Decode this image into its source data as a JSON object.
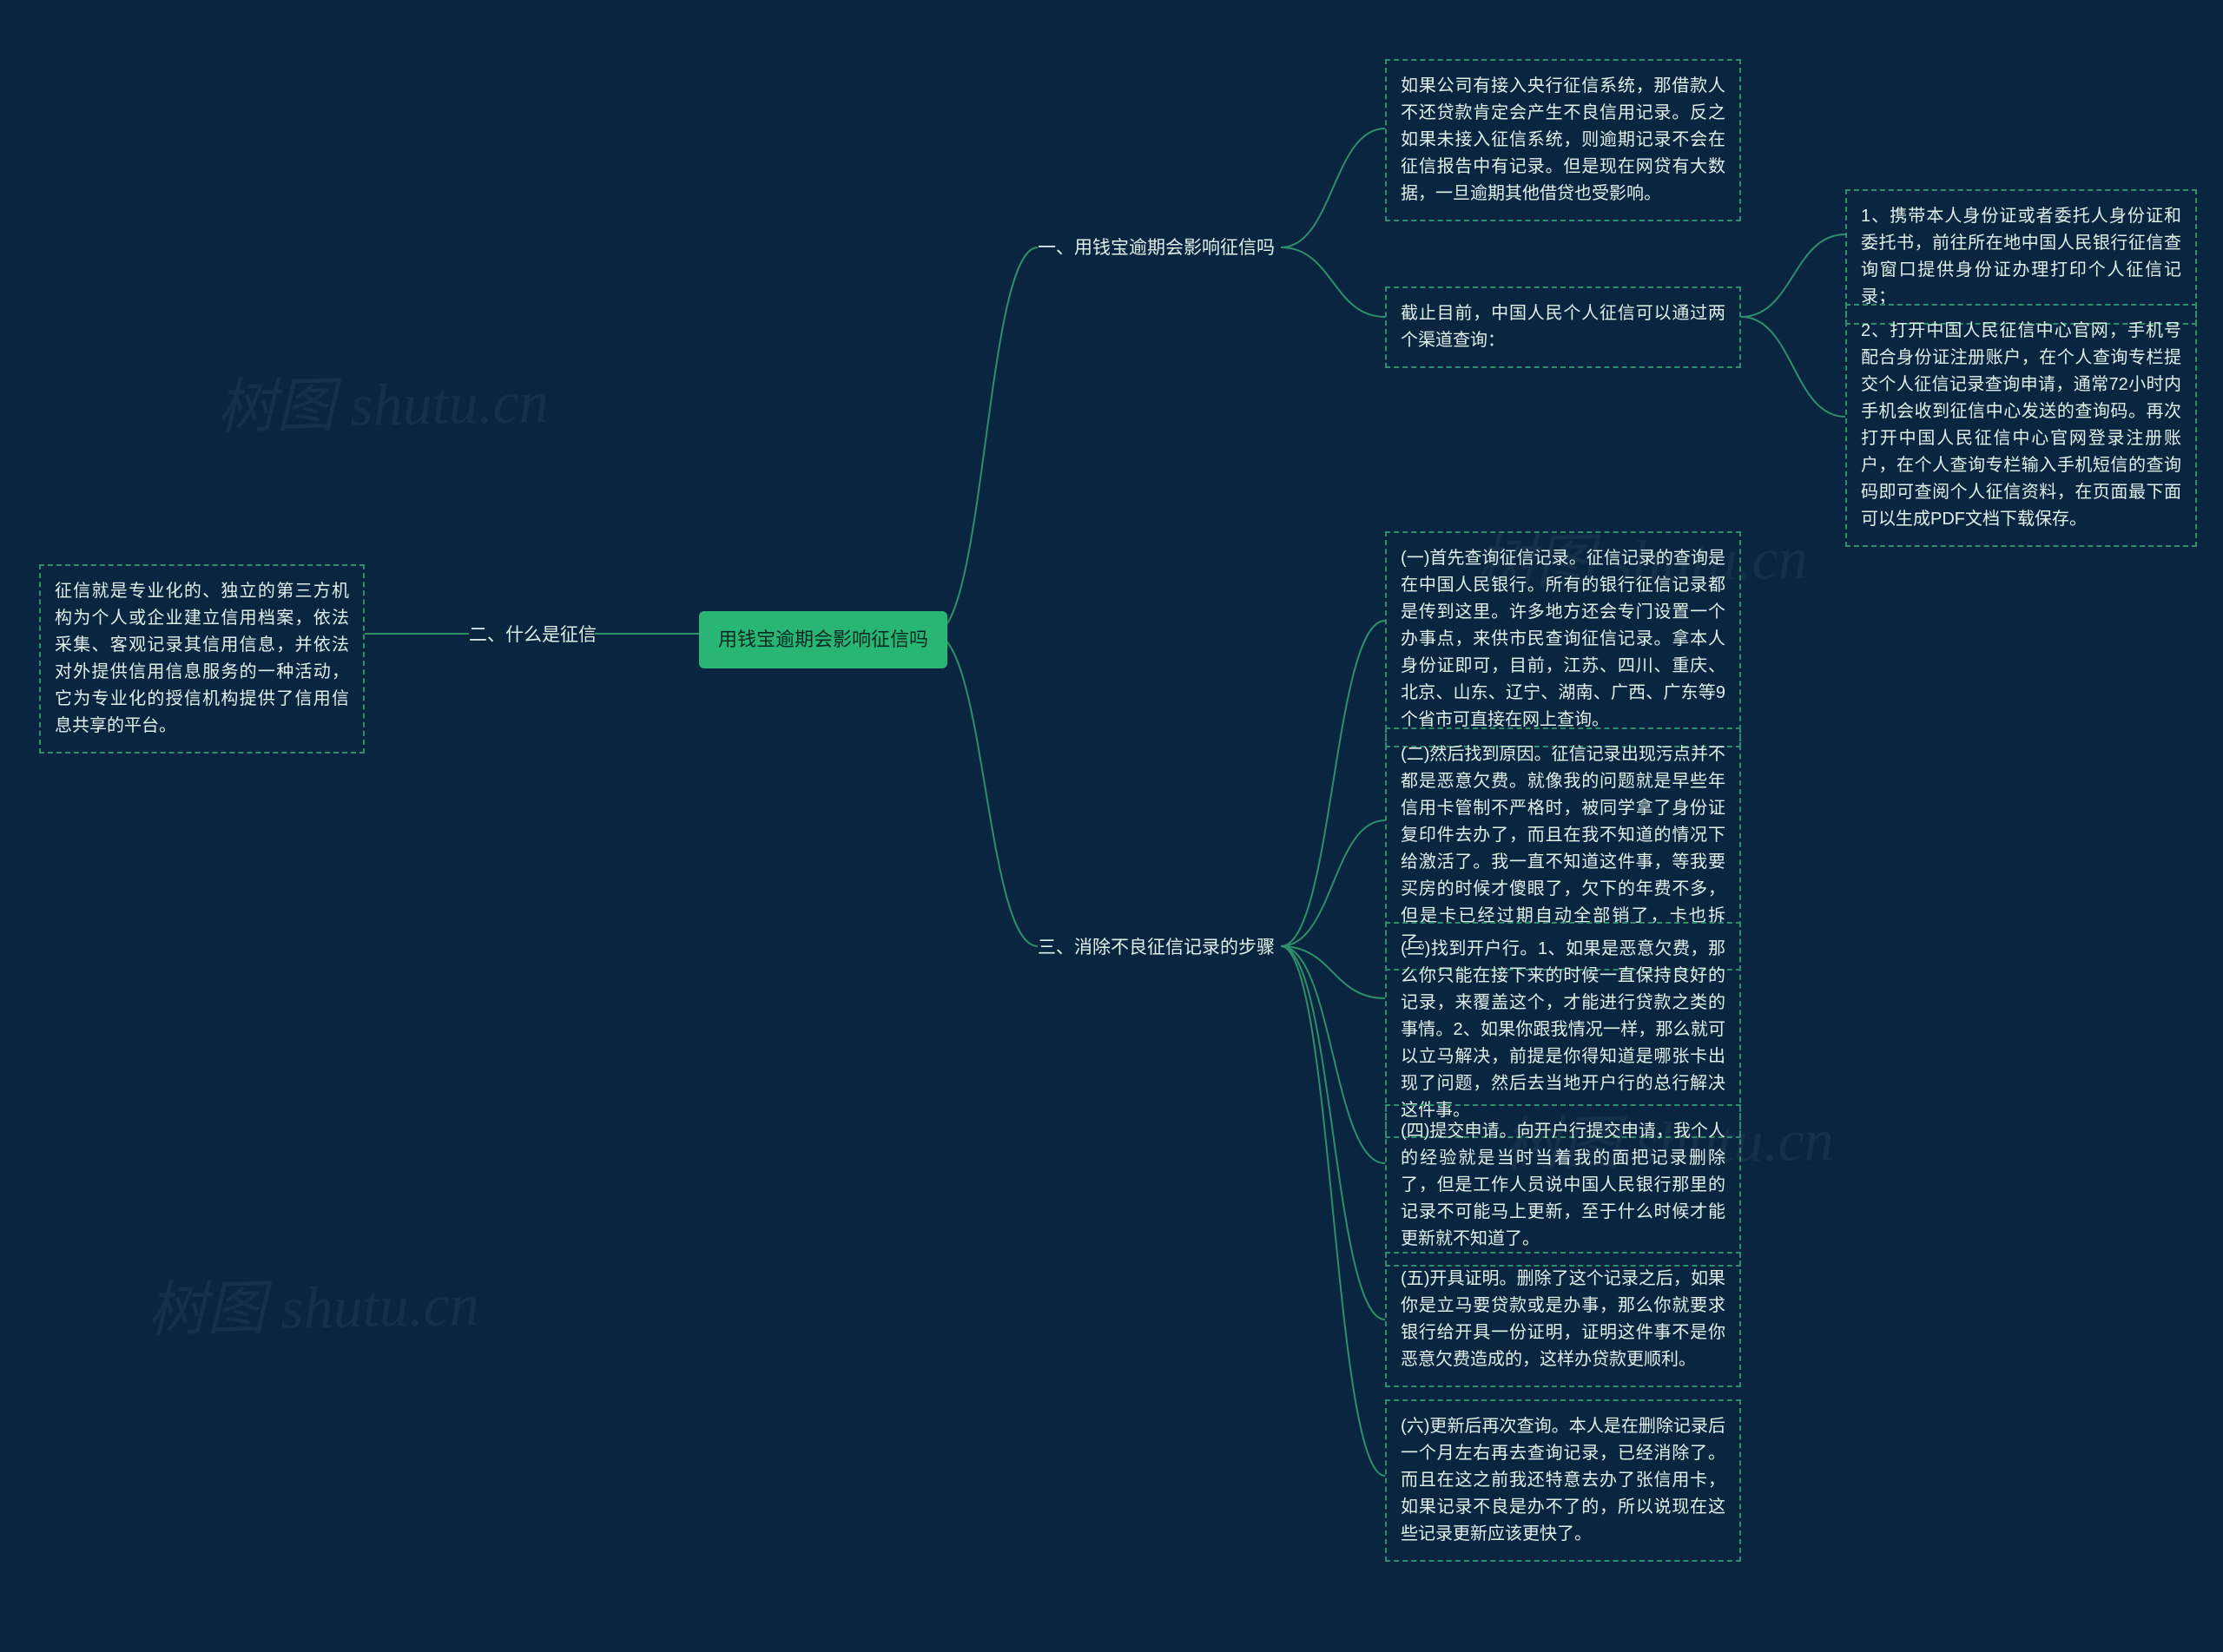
{
  "root": {
    "title": "用钱宝逾期会影响征信吗"
  },
  "branch1": {
    "title": "一、用钱宝逾期会影响征信吗",
    "leaf_a": "如果公司有接入央行征信系统，那借款人不还贷款肯定会产生不良信用记录。反之如果未接入征信系统，则逾期记录不会在征信报告中有记录。但是现在网贷有大数据，一旦逾期其他借贷也受影响。",
    "leaf_b": "截止目前，中国人民个人征信可以通过两个渠道查询：",
    "leaf_b_1": "1、携带本人身份证或者委托人身份证和委托书，前往所在地中国人民银行征信查询窗口提供身份证办理打印个人征信记录；",
    "leaf_b_2": "2、打开中国人民征信中心官网，手机号配合身份证注册账户，在个人查询专栏提交个人征信记录查询申请，通常72小时内手机会收到征信中心发送的查询码。再次打开中国人民征信中心官网登录注册账户，在个人查询专栏输入手机短信的查询码即可查阅个人征信资料，在页面最下面可以生成PDF文档下载保存。"
  },
  "branch2": {
    "title": "二、什么是征信",
    "leaf": "征信就是专业化的、独立的第三方机构为个人或企业建立信用档案，依法采集、客观记录其信用信息，并依法对外提供信用信息服务的一种活动，它为专业化的授信机构提供了信用信息共享的平台。"
  },
  "branch3": {
    "title": "三、消除不良征信记录的步骤",
    "leaf_1": "(一)首先查询征信记录。征信记录的查询是在中国人民银行。所有的银行征信记录都是传到这里。许多地方还会专门设置一个办事点，来供市民查询征信记录。拿本人身份证即可，目前，江苏、四川、重庆、北京、山东、辽宁、湖南、广西、广东等9个省市可直接在网上查询。",
    "leaf_2": "(二)然后找到原因。征信记录出现污点并不都是恶意欠费。就像我的问题就是早些年信用卡管制不严格时，被同学拿了身份证复印件去办了，而且在我不知道的情况下给激活了。我一直不知道这件事，等我要买房的时候才傻眼了，欠下的年费不多，但是卡已经过期自动全部销了，卡也拆了。",
    "leaf_3": "(三)找到开户行。1、如果是恶意欠费，那么你只能在接下来的时候一直保持良好的记录，来覆盖这个，才能进行贷款之类的事情。2、如果你跟我情况一样，那么就可以立马解决，前提是你得知道是哪张卡出现了问题，然后去当地开户行的总行解决这件事。",
    "leaf_4": "(四)提交申请。向开户行提交申请，我个人的经验就是当时当着我的面把记录删除了，但是工作人员说中国人民银行那里的记录不可能马上更新，至于什么时候才能更新就不知道了。",
    "leaf_5": "(五)开具证明。删除了这个记录之后，如果你是立马要贷款或是办事，那么你就要求银行给开具一份证明，证明这件事不是你恶意欠费造成的，这样办贷款更顺利。",
    "leaf_6": "(六)更新后再次查询。本人是在删除记录后一个月左右再去查询记录，已经消除了。而且在这之前我还特意去办了张信用卡，如果记录不良是办不了的，所以说现在这些记录更新应该更快了。"
  },
  "watermark": "树图 shutu.cn"
}
